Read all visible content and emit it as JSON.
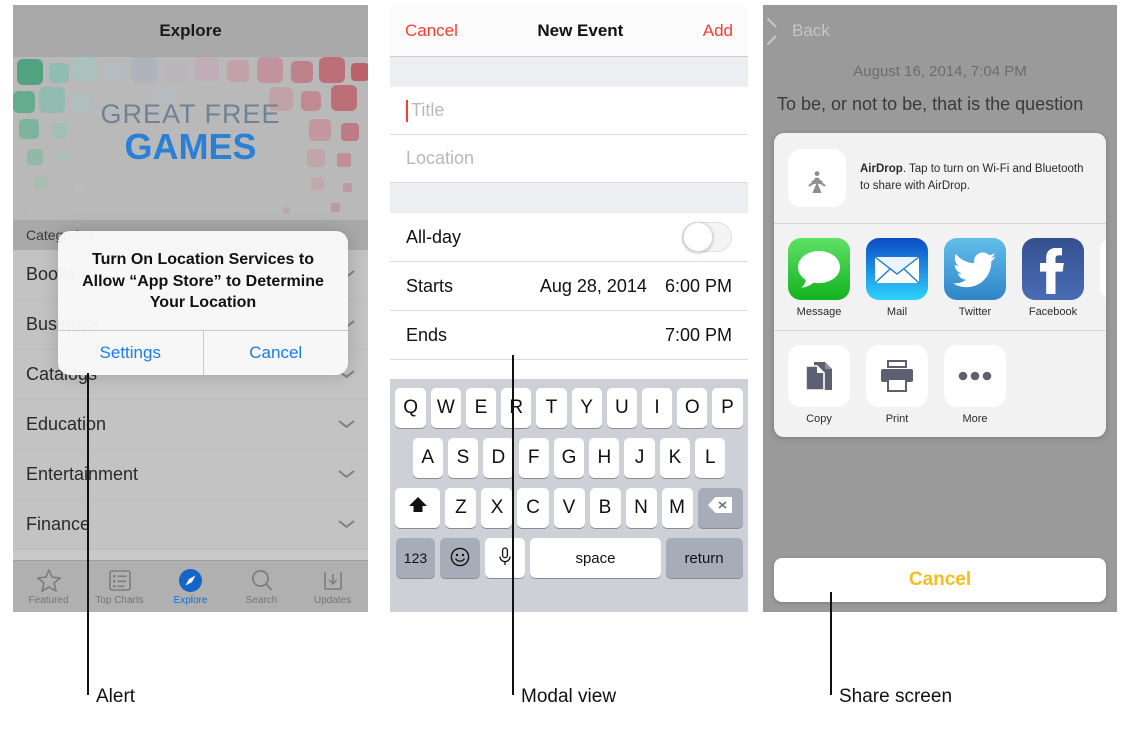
{
  "callouts": [
    {
      "label": "Alert"
    },
    {
      "label": "Modal view"
    },
    {
      "label": "Share screen"
    }
  ],
  "app_store": {
    "navbar": {
      "title": "Explore"
    },
    "banner": {
      "line1": "GREAT FREE",
      "line2": "GAMES"
    },
    "section_header": "Categories",
    "rows": [
      {
        "label": "Books"
      },
      {
        "label": "Business"
      },
      {
        "label": "Catalogs"
      },
      {
        "label": "Education"
      },
      {
        "label": "Entertainment"
      },
      {
        "label": "Finance"
      }
    ],
    "tabs": [
      {
        "label": "Featured",
        "icon": "star-icon",
        "active": false
      },
      {
        "label": "Top Charts",
        "icon": "list-icon",
        "active": false
      },
      {
        "label": "Explore",
        "icon": "compass-icon",
        "active": true
      },
      {
        "label": "Search",
        "icon": "search-icon",
        "active": false
      },
      {
        "label": "Updates",
        "icon": "download-icon",
        "active": false
      }
    ],
    "alert": {
      "title": "Turn On Location Services to Allow “App Store” to Determine Your Location",
      "settings_label": "Settings",
      "cancel_label": "Cancel",
      "button_color": "#1a7cf0"
    }
  },
  "new_event": {
    "navbar": {
      "cancel_label": "Cancel",
      "title": "New Event",
      "add_label": "Add",
      "action_color": "#ff3b30"
    },
    "title_placeholder": "Title",
    "location_placeholder": "Location",
    "all_day": {
      "label": "All-day",
      "value": "off"
    },
    "starts": {
      "label": "Starts",
      "date": "Aug 28, 2014",
      "time": "6:00 PM"
    },
    "ends": {
      "label": "Ends",
      "date": "",
      "time": "7:00 PM"
    },
    "keyboard": {
      "row1": [
        "Q",
        "W",
        "E",
        "R",
        "T",
        "Y",
        "U",
        "I",
        "O",
        "P"
      ],
      "row2": [
        "A",
        "S",
        "D",
        "F",
        "G",
        "H",
        "J",
        "K",
        "L"
      ],
      "row3": [
        "Z",
        "X",
        "C",
        "V",
        "B",
        "N",
        "M"
      ],
      "shift_icon": "shift-arrow-icon",
      "delete_icon": "backspace-icon",
      "numbers_label": "123",
      "emoji_icon": "smiley-icon",
      "dictation_icon": "microphone-icon",
      "space_label": "space",
      "return_label": "return"
    }
  },
  "share": {
    "navbar": {
      "back_label": "Back"
    },
    "note_date": "August 16, 2014, 7:04 PM",
    "note_text": "To be, or not to be, that is the question",
    "airdrop": {
      "icon": "airdrop-icon",
      "title": "AirDrop",
      "description": ". Tap to turn on Wi-Fi and Bluetooth to share with AirDrop."
    },
    "apps": [
      {
        "label": "Message",
        "icon": "messages-icon",
        "color": "#3ccc4a"
      },
      {
        "label": "Mail",
        "icon": "mail-icon",
        "color": "#1ab4f5"
      },
      {
        "label": "Twitter",
        "icon": "twitter-icon",
        "color": "#4aa8e0"
      },
      {
        "label": "Facebook",
        "icon": "facebook-icon",
        "color": "#3b5a9b"
      }
    ],
    "actions": [
      {
        "label": "Copy",
        "icon": "copy-icon"
      },
      {
        "label": "Print",
        "icon": "printer-icon"
      },
      {
        "label": "More",
        "icon": "ellipsis-icon"
      }
    ],
    "cancel_label": "Cancel",
    "cancel_color": "#f5be1e"
  }
}
